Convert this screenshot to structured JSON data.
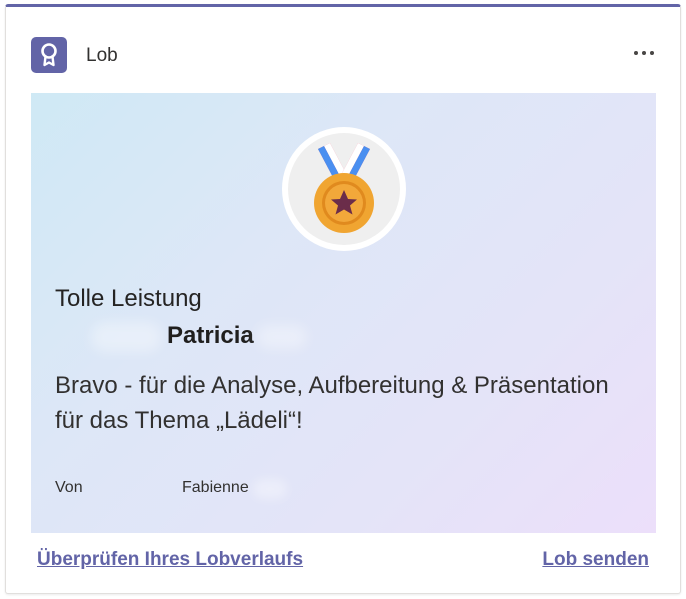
{
  "card": {
    "app_title": "Lob",
    "app_icon": "ribbon-badge-icon",
    "more_icon": "more-horizontal-icon",
    "accent_color": "#6264a7"
  },
  "praise": {
    "badge_icon": "medal-icon",
    "title": "Tolle Leistung",
    "recipient": "Patricia",
    "message": "Bravo - für die Analyse, Aufbereitung & Präsentation für das Thema „Lädeli“!",
    "from_label": "Von",
    "from_name": "Fabienne"
  },
  "footer": {
    "history_link": "Überprüfen Ihres Lobverlaufs",
    "send_link": "Lob senden"
  }
}
